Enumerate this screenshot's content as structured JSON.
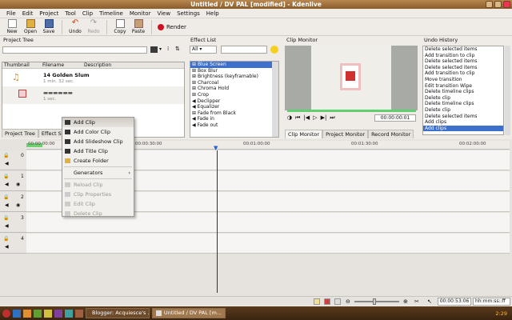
{
  "window": {
    "title": "Untitled / DV PAL [modified] - Kdenlive"
  },
  "menu": [
    "File",
    "Edit",
    "Project",
    "Tool",
    "Clip",
    "Timeline",
    "Monitor",
    "View",
    "Settings",
    "Help"
  ],
  "toolbar": {
    "new": "New",
    "open": "Open",
    "save": "Save",
    "undo": "Undo",
    "redo": "Redo",
    "copy": "Copy",
    "paste": "Paste",
    "render": "Render"
  },
  "project_tree": {
    "title": "Project Tree",
    "columns": [
      "Thumbnail",
      "Filename",
      "Description"
    ],
    "rows": [
      {
        "filename": "14 Golden Slum",
        "duration": "1 min. 32 sec."
      },
      {
        "filename": "▬▬▬▬▬▬",
        "duration": "1 sec."
      }
    ],
    "tabs": [
      "Project Tree",
      "Effect Stack"
    ]
  },
  "effect_list": {
    "title": "Effect List",
    "filter": "All",
    "items": [
      "Blue Screen",
      "Box Blur",
      "Brightness (keyframable)",
      "Charcoal",
      "Chroma Hold",
      "Crop",
      "Declipper",
      "Equalizer",
      "Fade from Black",
      "Fade in",
      "Fade out"
    ],
    "selected": 0
  },
  "clip_monitor": {
    "title": "Clip Monitor",
    "timecode": "00:00:00:01",
    "tabs": [
      "Clip Monitor",
      "Project Monitor",
      "Record Monitor"
    ]
  },
  "undo_history": {
    "title": "Undo History",
    "items": [
      "Delete selected items",
      "Add transition to clip",
      "Delete selected items",
      "Delete selected items",
      "Add transition to clip",
      "Move transition",
      "Edit transition Wipe",
      "Delete timeline clips",
      "Delete clip",
      "Delete timeline clips",
      "Delete clip",
      "Delete selected items",
      "Add clips",
      "Add clips"
    ],
    "selected": 13
  },
  "context_menu": {
    "items": [
      {
        "label": "Add Clip",
        "enabled": true,
        "highlight": true
      },
      {
        "label": "Add Color Clip",
        "enabled": true
      },
      {
        "label": "Add Slideshow Clip",
        "enabled": true
      },
      {
        "label": "Add Title Clip",
        "enabled": true
      },
      {
        "label": "Create Folder",
        "enabled": true
      },
      {
        "label": "Generators",
        "enabled": true,
        "submenu": true
      },
      {
        "label": "Reload Clip",
        "enabled": false
      },
      {
        "label": "Clip Properties",
        "enabled": false
      },
      {
        "label": "Edit Clip",
        "enabled": false
      },
      {
        "label": "Delete Clip",
        "enabled": false
      }
    ]
  },
  "timeline": {
    "ruler": [
      "00:00:00:00",
      "00:00:30:00",
      "00:01:00:00",
      "00:01:30:00",
      "00:02:00:00"
    ],
    "tracks": [
      "0",
      "1",
      "2",
      "3",
      "4"
    ],
    "status_time": "00:00:53:06",
    "time_format": "hh:mm:ss::ff"
  },
  "taskbar": {
    "tasks": [
      "Blogger: Acquiesce's ...",
      "Untitled / DV PAL [m..."
    ],
    "clock": "2:29"
  },
  "colors": {
    "accent": "#3d6fcc",
    "titlebar": "#a87844",
    "taskbar": "#4a2f16"
  }
}
